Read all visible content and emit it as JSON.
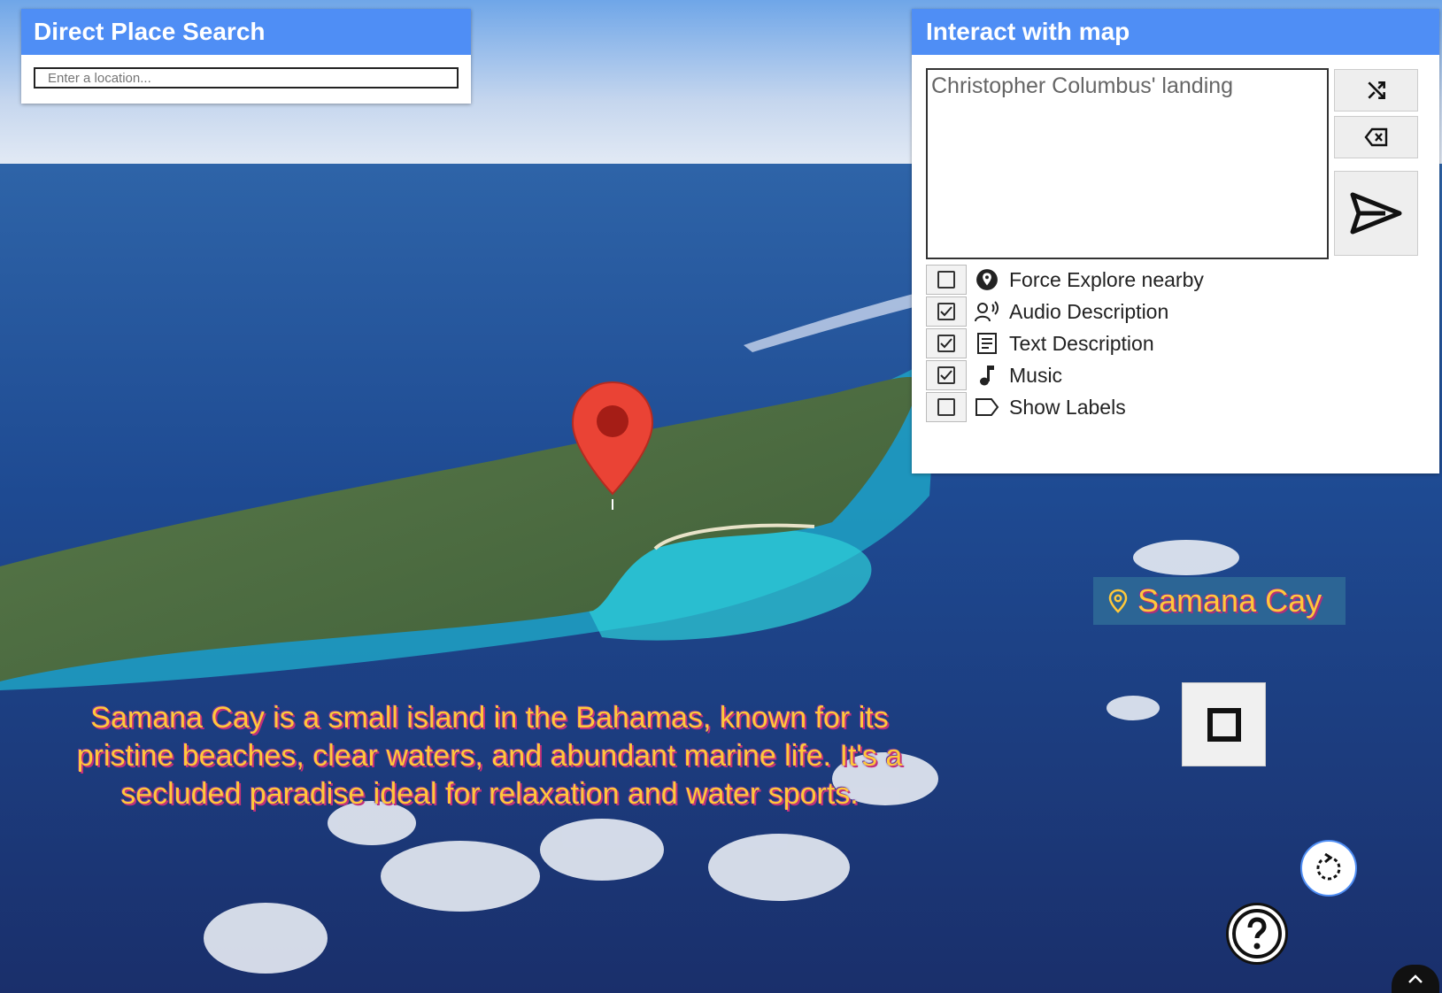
{
  "search_panel": {
    "title": "Direct Place Search",
    "placeholder": "Enter a location..."
  },
  "interact_panel": {
    "title": "Interact with map",
    "prompt_value": "Christopher Columbus' landing",
    "buttons": {
      "shuffle_icon": "shuffle-icon",
      "clear_icon": "backspace-icon",
      "send_icon": "send-icon"
    },
    "options": [
      {
        "label": "Force Explore nearby",
        "checked": false,
        "icon": "location-pin-icon"
      },
      {
        "label": "Audio Description",
        "checked": true,
        "icon": "voice-icon"
      },
      {
        "label": "Text Description",
        "checked": true,
        "icon": "document-icon"
      },
      {
        "label": "Music",
        "checked": true,
        "icon": "music-note-icon"
      },
      {
        "label": "Show Labels",
        "checked": false,
        "icon": "label-tag-icon"
      }
    ]
  },
  "place_label": {
    "name": "Samana Cay",
    "icon": "location-pin-icon"
  },
  "caption": {
    "text": "Samana Cay is a small island in the Bahamas, known for its pristine beaches, clear waters, and abundant marine life. It's a secluded paradise ideal for relaxation and water sports."
  },
  "colors": {
    "panel_header": "#4f8ef5",
    "caption_text": "#ffc83a",
    "label_background": "#2c6595",
    "marker_red": "#ea4335"
  }
}
